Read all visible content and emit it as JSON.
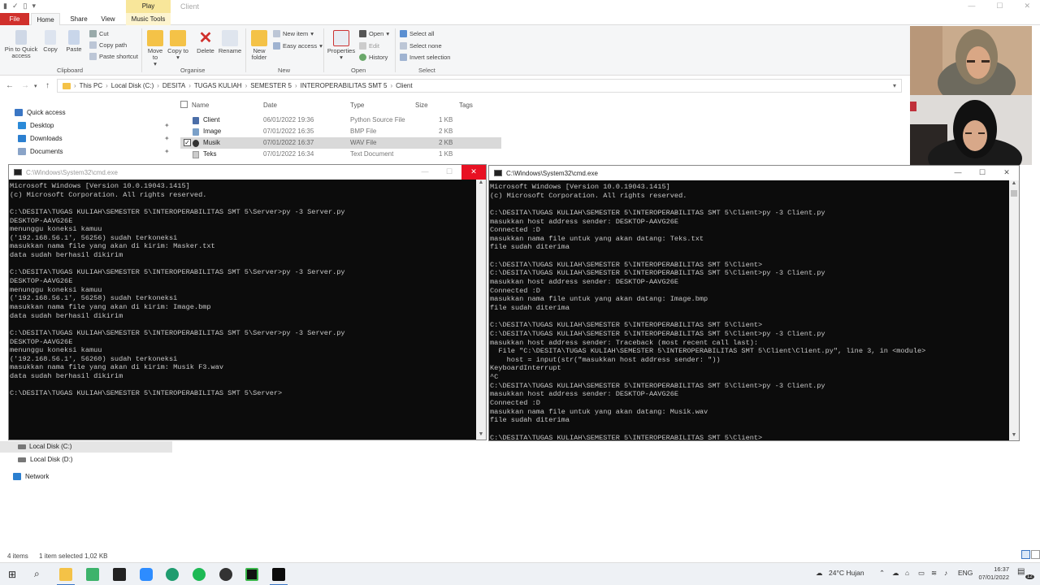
{
  "explorer": {
    "title": "Client",
    "context_group": "Play",
    "tabs": [
      "File",
      "Home",
      "Share",
      "View",
      "Music Tools"
    ],
    "ribbon": {
      "clipboard": {
        "pin": "Pin to Quick access",
        "copy": "Copy",
        "paste": "Paste",
        "cut": "Cut",
        "copy_path": "Copy path",
        "paste_shortcut": "Paste shortcut",
        "group": "Clipboard"
      },
      "organise": {
        "move_to": "Move to",
        "copy_to": "Copy to",
        "delete": "Delete",
        "rename": "Rename",
        "group": "Organise"
      },
      "new": {
        "new_folder": "New folder",
        "new_item": "New item",
        "easy_access": "Easy access",
        "group": "New"
      },
      "open": {
        "properties": "Properties",
        "open": "Open",
        "edit": "Edit",
        "history": "History",
        "group": "Open"
      },
      "select": {
        "select_all": "Select all",
        "select_none": "Select none",
        "invert": "Invert selection",
        "group": "Select"
      }
    },
    "breadcrumb": [
      "This PC",
      "Local Disk (C:)",
      "DESITA",
      "TUGAS KULIAH",
      "SEMESTER 5",
      "INTEROPERABILITAS SMT 5",
      "Client"
    ],
    "nav": {
      "quick_access": "Quick access",
      "desktop": "Desktop",
      "downloads": "Downloads",
      "documents": "Documents",
      "local_c": "Local Disk (C:)",
      "local_d": "Local Disk (D:)",
      "network": "Network"
    },
    "columns": {
      "name": "Name",
      "date": "Date",
      "type": "Type",
      "size": "Size",
      "tags": "Tags"
    },
    "files": [
      {
        "name": "Client",
        "date": "06/01/2022 19:36",
        "type": "Python Source File",
        "size": "1 KB"
      },
      {
        "name": "Image",
        "date": "07/01/2022 16:35",
        "type": "BMP File",
        "size": "2 KB"
      },
      {
        "name": "Musik",
        "date": "07/01/2022 16:37",
        "type": "WAV File",
        "size": "2 KB"
      },
      {
        "name": "Teks",
        "date": "07/01/2022 16:34",
        "type": "Text Document",
        "size": "1 KB"
      }
    ],
    "status": {
      "items": "4 items",
      "selected": "1 item selected  1,02 KB"
    }
  },
  "cmd_left": {
    "title": "C:\\Windows\\System32\\cmd.exe",
    "lines": [
      "Microsoft Windows [Version 10.0.19043.1415]",
      "(c) Microsoft Corporation. All rights reserved.",
      "",
      "C:\\DESITA\\TUGAS KULIAH\\SEMESTER 5\\INTEROPERABILITAS SMT 5\\Server>py -3 Server.py",
      "DESKTOP-AAVG26E",
      "menunggu koneksi kamuu",
      "('192.168.56.1', 56256) sudah terkoneksi",
      "masukkan nama file yang akan di kirim: Masker.txt",
      "data sudah berhasil dikirim",
      "",
      "C:\\DESITA\\TUGAS KULIAH\\SEMESTER 5\\INTEROPERABILITAS SMT 5\\Server>py -3 Server.py",
      "DESKTOP-AAVG26E",
      "menunggu koneksi kamuu",
      "('192.168.56.1', 56258) sudah terkoneksi",
      "masukkan nama file yang akan di kirim: Image.bmp",
      "data sudah berhasil dikirim",
      "",
      "C:\\DESITA\\TUGAS KULIAH\\SEMESTER 5\\INTEROPERABILITAS SMT 5\\Server>py -3 Server.py",
      "DESKTOP-AAVG26E",
      "menunggu koneksi kamuu",
      "('192.168.56.1', 56260) sudah terkoneksi",
      "masukkan nama file yang akan di kirim: Musik F3.wav",
      "data sudah berhasil dikirim",
      "",
      "C:\\DESITA\\TUGAS KULIAH\\SEMESTER 5\\INTEROPERABILITAS SMT 5\\Server>"
    ]
  },
  "cmd_right": {
    "title": "C:\\Windows\\System32\\cmd.exe",
    "lines": [
      "Microsoft Windows [Version 10.0.19043.1415]",
      "(c) Microsoft Corporation. All rights reserved.",
      "",
      "C:\\DESITA\\TUGAS KULIAH\\SEMESTER 5\\INTEROPERABILITAS SMT 5\\Client>py -3 Client.py",
      "masukkan host address sender: DESKTOP-AAVG26E",
      "Connected :D",
      "masukkan nama file untuk yang akan datang: Teks.txt",
      "file sudah diterima",
      "",
      "C:\\DESITA\\TUGAS KULIAH\\SEMESTER 5\\INTEROPERABILITAS SMT 5\\Client>",
      "C:\\DESITA\\TUGAS KULIAH\\SEMESTER 5\\INTEROPERABILITAS SMT 5\\Client>py -3 Client.py",
      "masukkan host address sender: DESKTOP-AAVG26E",
      "Connected :D",
      "masukkan nama file untuk yang akan datang: Image.bmp",
      "file sudah diterima",
      "",
      "C:\\DESITA\\TUGAS KULIAH\\SEMESTER 5\\INTEROPERABILITAS SMT 5\\Client>",
      "C:\\DESITA\\TUGAS KULIAH\\SEMESTER 5\\INTEROPERABILITAS SMT 5\\Client>py -3 Client.py",
      "masukkan host address sender: Traceback (most recent call last):",
      "  File \"C:\\DESITA\\TUGAS KULIAH\\SEMESTER 5\\INTEROPERABILITAS SMT 5\\Client\\Client.py\", line 3, in <module>",
      "    host = input(str(\"masukkan host address sender: \"))",
      "KeyboardInterrupt",
      "^C",
      "C:\\DESITA\\TUGAS KULIAH\\SEMESTER 5\\INTEROPERABILITAS SMT 5\\Client>py -3 Client.py",
      "masukkan host address sender: DESKTOP-AAVG26E",
      "Connected :D",
      "masukkan nama file untuk yang akan datang: Musik.wav",
      "file sudah diterima",
      "",
      "C:\\DESITA\\TUGAS KULIAH\\SEMESTER 5\\INTEROPERABILITAS SMT 5\\Client>"
    ]
  },
  "taskbar": {
    "weather": "24°C  Hujan",
    "lang": "ENG",
    "time": "16:37",
    "date": "07/01/2022",
    "notifications": "12"
  },
  "colors": {
    "file_tab": "#d0302c",
    "accent": "#3a76c4",
    "cmd_bg": "#0c0c0c",
    "close_red": "#e81123",
    "folder": "#f4c247"
  }
}
